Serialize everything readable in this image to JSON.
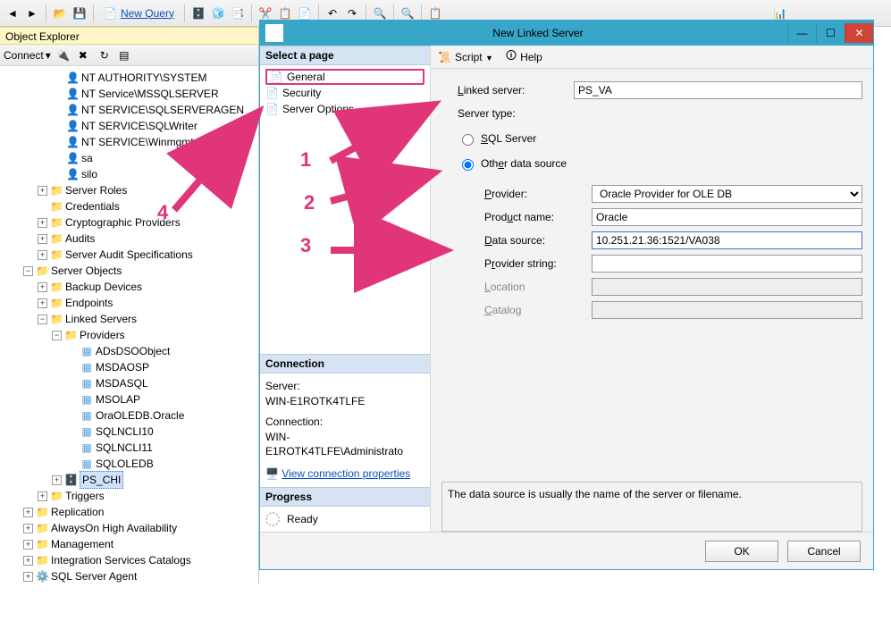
{
  "top_toolbar": {
    "new_query": "New Query"
  },
  "object_explorer": {
    "title": "Object Explorer",
    "connect_label": "Connect",
    "tree": {
      "logins": [
        "NT AUTHORITY\\SYSTEM",
        "NT Service\\MSSQLSERVER",
        "NT SERVICE\\SQLSERVERAGEN",
        "NT SERVICE\\SQLWriter",
        "NT SERVICE\\Winmgmt",
        "sa",
        "silo"
      ],
      "server_roles": "Server Roles",
      "credentials": "Credentials",
      "cryptographic_providers": "Cryptographic Providers",
      "audits": "Audits",
      "server_audit_specs": "Server Audit Specifications",
      "server_objects": "Server Objects",
      "backup_devices": "Backup Devices",
      "endpoints": "Endpoints",
      "linked_servers": "Linked Servers",
      "providers": "Providers",
      "provider_list": [
        "ADsDSOObject",
        "MSDAOSP",
        "MSDASQL",
        "MSOLAP",
        "OraOLEDB.Oracle",
        "SQLNCLI10",
        "SQLNCLI11",
        "SQLOLEDB"
      ],
      "ps_chi": "PS_CHI",
      "triggers": "Triggers",
      "replication": "Replication",
      "always_on": "AlwaysOn High Availability",
      "management": "Management",
      "integration_services": "Integration Services Catalogs",
      "sql_server_agent": "SQL Server Agent"
    }
  },
  "dialog": {
    "title": "New Linked Server",
    "select_page": "Select a page",
    "pages": {
      "general": "General",
      "security": "Security",
      "server_options": "Server Options"
    },
    "connection_head": "Connection",
    "connection": {
      "server_label": "Server:",
      "server_value": "WIN-E1ROTK4TLFE",
      "conn_label": "Connection:",
      "conn_value": "WIN-E1ROTK4TLFE\\Administrato",
      "view_link": "View connection properties"
    },
    "progress_head": "Progress",
    "progress_value": "Ready",
    "script_label": "Script",
    "help_label": "Help",
    "form": {
      "linked_server_label": "Linked server:",
      "linked_server_value": "PS_VA",
      "server_type_label": "Server type:",
      "radio_sql": "SQL Server",
      "radio_other": "Other data source",
      "provider_label": "Provider:",
      "provider_value": "Oracle Provider for OLE DB",
      "product_label": "Product name:",
      "product_value": "Oracle",
      "datasource_label": "Data source:",
      "datasource_value": "10.251.21.36:1521/VA038",
      "provstring_label": "Provider string:",
      "provstring_value": "",
      "location_label": "Location",
      "catalog_label": "Catalog"
    },
    "desc": "The data source is usually the name of the server or filename.",
    "ok": "OK",
    "cancel": "Cancel"
  },
  "annotations": {
    "n1": "1",
    "n2": "2",
    "n3": "3",
    "n4": "4"
  }
}
